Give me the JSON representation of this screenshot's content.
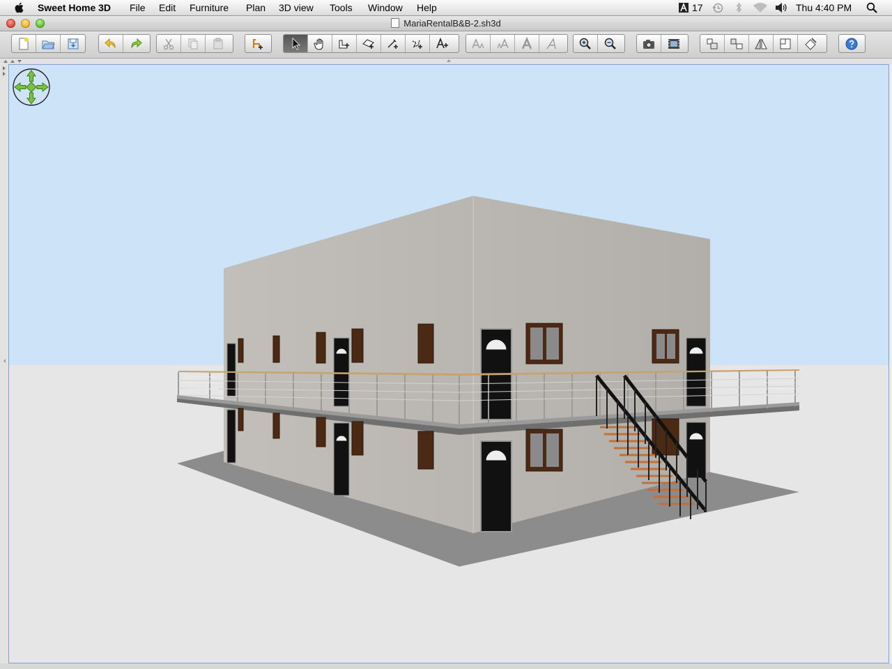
{
  "menubar": {
    "app_name": "Sweet Home 3D",
    "items": [
      "File",
      "Edit",
      "Furniture",
      "Plan",
      "3D view",
      "Tools",
      "Window",
      "Help"
    ],
    "status": {
      "adobe_count": "17",
      "clock": "Thu 4:40 PM"
    }
  },
  "window": {
    "title": "MariaRentalB&B-2.sh3d"
  },
  "toolbar": {
    "groups": [
      [
        "new-home-icon",
        "open-icon",
        "save-icon"
      ],
      [
        "undo-icon",
        "redo-icon"
      ],
      [
        "cut-icon",
        "copy-icon",
        "paste-icon"
      ],
      [
        "add-furniture-icon"
      ],
      [
        "select-mode-icon",
        "pan-mode-icon",
        "create-walls-icon",
        "create-rooms-icon",
        "create-dimensions-icon",
        "create-polylines-icon",
        "add-text-icon"
      ],
      [
        "increase-text-size-icon",
        "decrease-text-size-icon",
        "bold-text-icon",
        "italic-text-icon"
      ],
      [
        "zoom-in-icon",
        "zoom-out-icon"
      ],
      [
        "create-photo-icon",
        "create-video-icon"
      ],
      [
        "group-icon",
        "ungroup-icon",
        "flip-icon",
        "modify-room-icon",
        "import-icon"
      ],
      [
        "help-icon"
      ]
    ],
    "selected": "select-mode-icon"
  },
  "view3d": {
    "sky_color": "#cde3f7",
    "ground_color": "#e6e6e6",
    "wall_color": "#bdbab4",
    "navigation_widget": "navigation-arrows-icon"
  }
}
